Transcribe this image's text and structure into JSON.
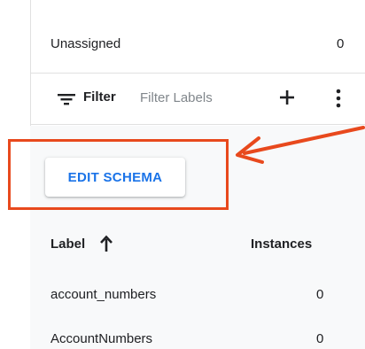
{
  "summary": {
    "unassigned_label": "Unassigned",
    "unassigned_count": "0"
  },
  "filter": {
    "label": "Filter",
    "placeholder": "Filter Labels",
    "icon": "filter-icon",
    "add_icon": "add-icon",
    "more_icon": "more-vert-icon"
  },
  "actions": {
    "edit_schema_label": "EDIT SCHEMA"
  },
  "table": {
    "columns": [
      {
        "label": "Label",
        "sort": "ascending",
        "sort_icon": "arrow-up-icon"
      },
      {
        "label": "Instances"
      }
    ],
    "rows": [
      {
        "name": "account_numbers",
        "count": "0"
      },
      {
        "name": "AccountNumbers",
        "count": "0"
      }
    ]
  },
  "annotation": {
    "highlight_color": "#e8491d",
    "pointer": "arrow-pointer"
  },
  "colors": {
    "accent": "#1a73e8",
    "text": "#202124",
    "placeholder": "#80868b",
    "panel_background": "#f8f9fa"
  }
}
